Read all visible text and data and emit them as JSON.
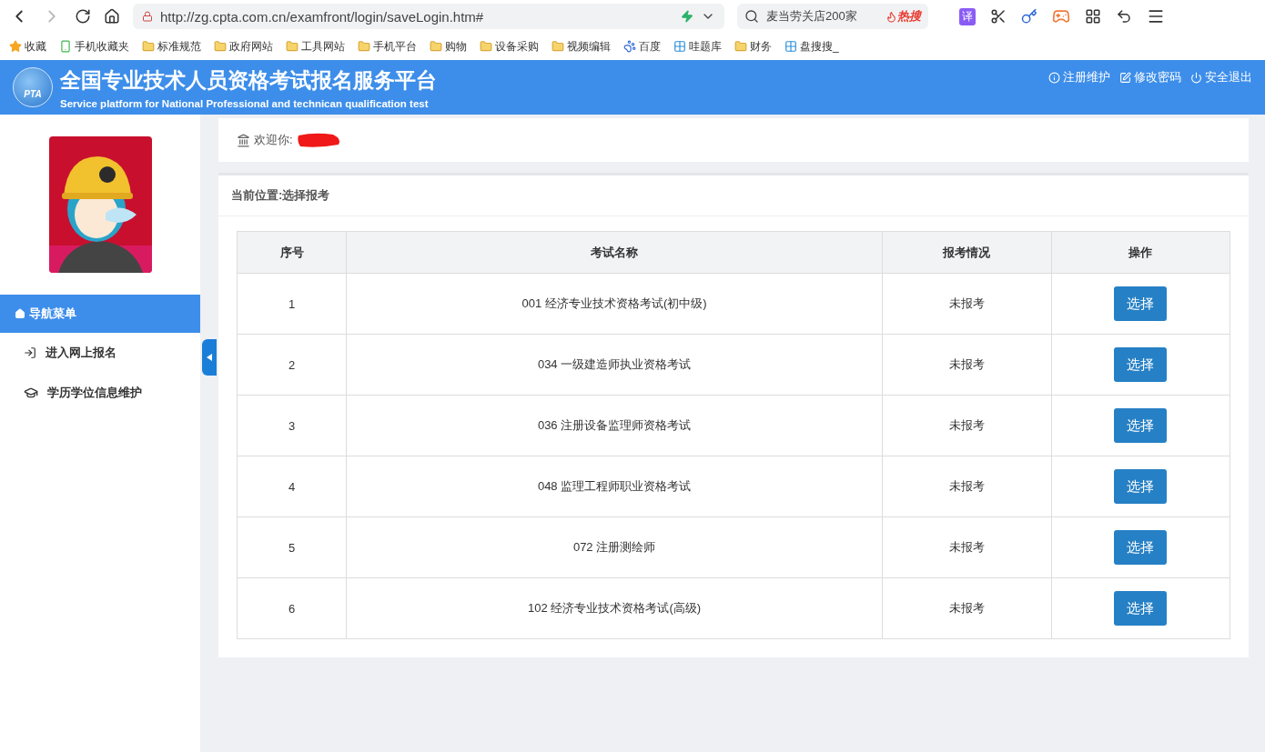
{
  "browser": {
    "url": "http://zg.cpta.com.cn/examfront/login/saveLogin.htm#",
    "search_placeholder": "麦当劳关店200家",
    "hot_label": "热搜",
    "translate_label": "译"
  },
  "bookmarks": [
    {
      "label": "收藏",
      "kind": "star"
    },
    {
      "label": "手机收藏夹",
      "kind": "phone"
    },
    {
      "label": "标准规范",
      "kind": "folder"
    },
    {
      "label": "政府网站",
      "kind": "folder"
    },
    {
      "label": "工具网站",
      "kind": "folder"
    },
    {
      "label": "手机平台",
      "kind": "folder"
    },
    {
      "label": "购物",
      "kind": "folder"
    },
    {
      "label": "设备采购",
      "kind": "folder"
    },
    {
      "label": "视频编辑",
      "kind": "folder"
    },
    {
      "label": "百度",
      "kind": "paw"
    },
    {
      "label": "哇题库",
      "kind": "site"
    },
    {
      "label": "财务",
      "kind": "folder"
    },
    {
      "label": "盘搜搜_",
      "kind": "site"
    }
  ],
  "header": {
    "logo_text": "PTA",
    "title": "全国专业技术人员资格考试报名服务平台",
    "subtitle": "Service platform for National Professional and technican qualification test",
    "links": [
      {
        "label": "注册维护",
        "kind": "info"
      },
      {
        "label": "修改密码",
        "kind": "edit"
      },
      {
        "label": "安全退出",
        "kind": "power"
      }
    ]
  },
  "sidebar": {
    "menu_title": "导航菜单",
    "items": [
      {
        "label": "进入网上报名",
        "kind": "signin",
        "selected": false
      },
      {
        "label": "学历学位信息维护",
        "kind": "cap",
        "selected": false
      }
    ]
  },
  "welcome": {
    "label": "欢迎你:"
  },
  "breadcrumb": "当前位置:选择报考",
  "table": {
    "columns": [
      "序号",
      "考试名称",
      "报考情况",
      "操作"
    ],
    "rows": [
      {
        "index": "1",
        "name": "001 经济专业技术资格考试(初中级)",
        "status": "未报考",
        "action": "选择"
      },
      {
        "index": "2",
        "name": "034 一级建造师执业资格考试",
        "status": "未报考",
        "action": "选择"
      },
      {
        "index": "3",
        "name": "036 注册设备监理师资格考试",
        "status": "未报考",
        "action": "选择"
      },
      {
        "index": "4",
        "name": "048 监理工程师职业资格考试",
        "status": "未报考",
        "action": "选择"
      },
      {
        "index": "5",
        "name": "072 注册测绘师",
        "status": "未报考",
        "action": "选择"
      },
      {
        "index": "6",
        "name": "102 经济专业技术资格考试(高级)",
        "status": "未报考",
        "action": "选择"
      }
    ]
  }
}
